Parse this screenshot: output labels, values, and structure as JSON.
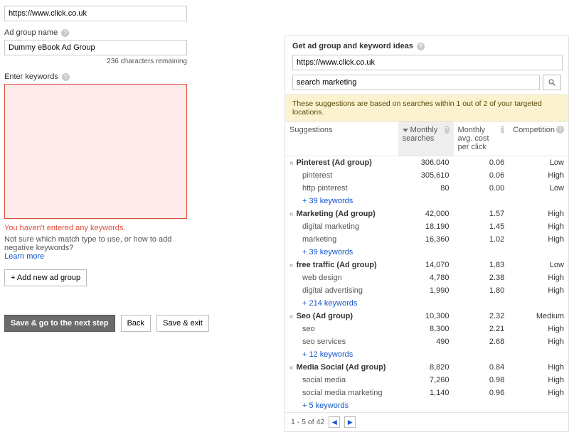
{
  "left": {
    "url_value": "https://www.click.co.uk",
    "ad_group_label": "Ad group name",
    "ad_group_value": "Dummy eBook Ad Group",
    "chars_remaining": "236 characters remaining",
    "enter_keywords_label": "Enter keywords",
    "error_msg": "You haven't entered any keywords.",
    "hint": "Not sure which match type to use, or how to add negative keywords?",
    "learn_more": "Learn more",
    "add_group_btn": "+ Add new ad group",
    "save_next": "Save & go to the next step",
    "back": "Back",
    "save_exit": "Save & exit"
  },
  "right": {
    "panel_title": "Get ad group and keyword ideas",
    "url_value": "https://www.click.co.uk",
    "search_value": "search marketing",
    "notice": "These suggestions are based on searches within 1 out of 2 of your targeted locations.",
    "headers": {
      "suggestions": "Suggestions",
      "monthly": "Monthly searches",
      "cpc": "Monthly avg. cost per click",
      "competition": "Competition"
    },
    "groups": [
      {
        "name": "Pinterest (Ad group)",
        "monthly": "306,040",
        "cpc": "0.06",
        "comp": "Low",
        "keywords": [
          {
            "name": "pinterest",
            "monthly": "305,610",
            "cpc": "0.06",
            "comp": "High"
          },
          {
            "name": "http pinterest",
            "monthly": "80",
            "cpc": "0.00",
            "comp": "Low"
          }
        ],
        "more": "+ 39 keywords"
      },
      {
        "name": "Marketing (Ad group)",
        "monthly": "42,000",
        "cpc": "1.57",
        "comp": "High",
        "keywords": [
          {
            "name": "digital marketing",
            "monthly": "18,190",
            "cpc": "1.45",
            "comp": "High"
          },
          {
            "name": "marketing",
            "monthly": "16,360",
            "cpc": "1.02",
            "comp": "High"
          }
        ],
        "more": "+ 39 keywords"
      },
      {
        "name": "free traffic (Ad group)",
        "monthly": "14,070",
        "cpc": "1.83",
        "comp": "Low",
        "keywords": [
          {
            "name": "web design",
            "monthly": "4,780",
            "cpc": "2.38",
            "comp": "High"
          },
          {
            "name": "digital advertising",
            "monthly": "1,990",
            "cpc": "1.80",
            "comp": "High"
          }
        ],
        "more": "+ 214 keywords"
      },
      {
        "name": "Seo (Ad group)",
        "monthly": "10,300",
        "cpc": "2.32",
        "comp": "Medium",
        "keywords": [
          {
            "name": "seo",
            "monthly": "8,300",
            "cpc": "2.21",
            "comp": "High"
          },
          {
            "name": "seo services",
            "monthly": "490",
            "cpc": "2.68",
            "comp": "High"
          }
        ],
        "more": "+ 12 keywords"
      },
      {
        "name": "Media Social (Ad group)",
        "monthly": "8,820",
        "cpc": "0.84",
        "comp": "High",
        "keywords": [
          {
            "name": "social media",
            "monthly": "7,260",
            "cpc": "0.98",
            "comp": "High"
          },
          {
            "name": "social media marketing",
            "monthly": "1,140",
            "cpc": "0.96",
            "comp": "High"
          }
        ],
        "more": "+ 5 keywords"
      }
    ],
    "pager_text": "1 - 5 of 42"
  }
}
